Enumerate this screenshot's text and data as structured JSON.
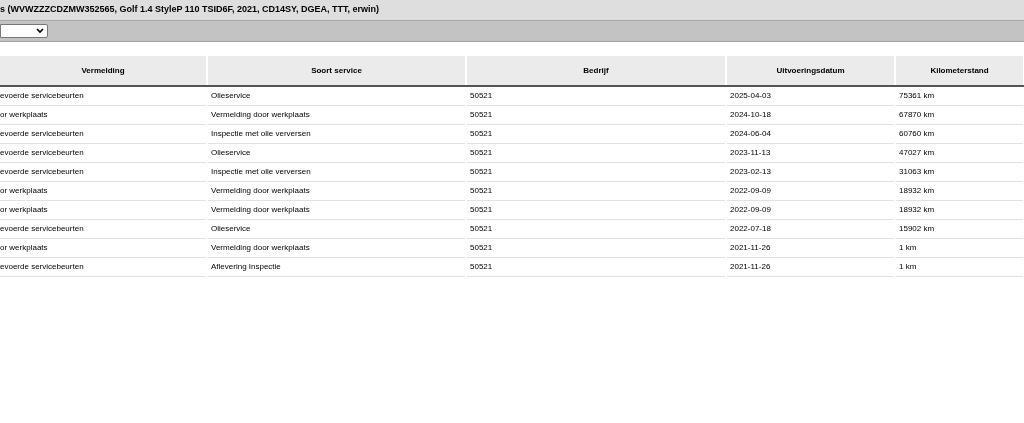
{
  "title": "s (WVWZZZCDZMW352565, Golf 1.4 StyleP 110 TSID6F, 2021, CD14SY, DGEA, TTT, erwin)",
  "table": {
    "columns": [
      "Vermelding",
      "Soort service",
      "Bedrijf",
      "Uitvoeringsdatum",
      "Kilometerstand"
    ],
    "rows": [
      [
        "evoerde servicebeurten",
        "Olieservice",
        "50521",
        "2025-04-03",
        "75361 km"
      ],
      [
        "or werkplaats",
        "Vermelding door werkplaats",
        "50521",
        "2024-10-18",
        "67870 km"
      ],
      [
        "evoerde servicebeurten",
        "Inspectie met olie verversen",
        "50521",
        "2024-06-04",
        "60760 km"
      ],
      [
        "evoerde servicebeurten",
        "Olieservice",
        "50521",
        "2023-11-13",
        "47027 km"
      ],
      [
        "evoerde servicebeurten",
        "Inspectie met olie verversen",
        "50521",
        "2023-02-13",
        "31063 km"
      ],
      [
        "or werkplaats",
        "Vermelding door werkplaats",
        "50521",
        "2022-09-09",
        "18932 km"
      ],
      [
        "or werkplaats",
        "Vermelding door werkplaats",
        "50521",
        "2022-09-09",
        "18932 km"
      ],
      [
        "evoerde servicebeurten",
        "Olieservice",
        "50521",
        "2022-07-18",
        "15902 km"
      ],
      [
        "or werkplaats",
        "Vermelding door werkplaats",
        "50521",
        "2021-11-26",
        "1 km"
      ],
      [
        "evoerde servicebeurten",
        "Aflevering Inspectie",
        "50521",
        "2021-11-26",
        "1 km"
      ]
    ]
  }
}
